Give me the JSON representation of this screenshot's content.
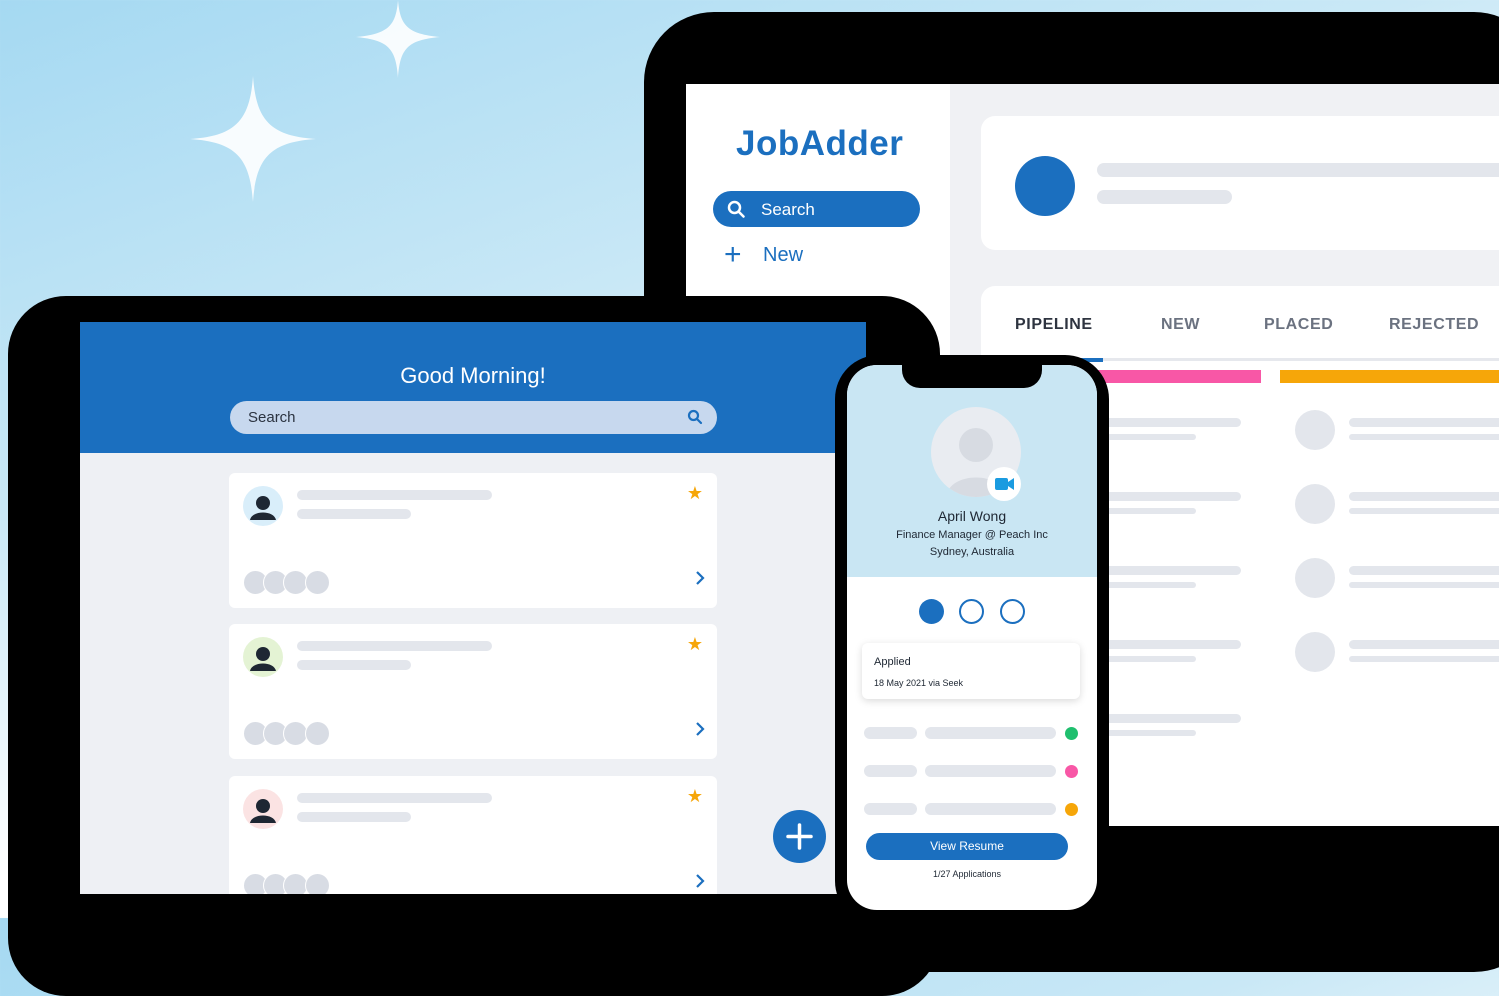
{
  "colors": {
    "brand": "#1b6fbf",
    "star": "#f6a609",
    "pipeline_pink": "#f857a6",
    "pipeline_yellow": "#f6a609",
    "status_green": "#1fbf6e",
    "status_pink": "#f857a6",
    "status_yellow": "#f6a609"
  },
  "laptop": {
    "logo": "JobAdder",
    "search_label": "Search",
    "new_label": "New",
    "tabs": [
      "PIPELINE",
      "NEW",
      "PLACED",
      "REJECTED"
    ],
    "active_tab": "PIPELINE"
  },
  "tablet": {
    "greeting": "Good Morning!",
    "search_placeholder": "Search",
    "cards": [
      {
        "avatar_bg": "#d9eefa",
        "starred": true
      },
      {
        "avatar_bg": "#e4f3d4",
        "starred": true
      },
      {
        "avatar_bg": "#fbe3e3",
        "starred": true
      }
    ]
  },
  "phone": {
    "name": "April Wong",
    "role": "Finance Manager @ Peach Inc",
    "location": "Sydney, Australia",
    "applied_title": "Applied",
    "applied_detail": "18 May 2021 via Seek",
    "resume_button": "View Resume",
    "applications": "1/27 Applications"
  }
}
